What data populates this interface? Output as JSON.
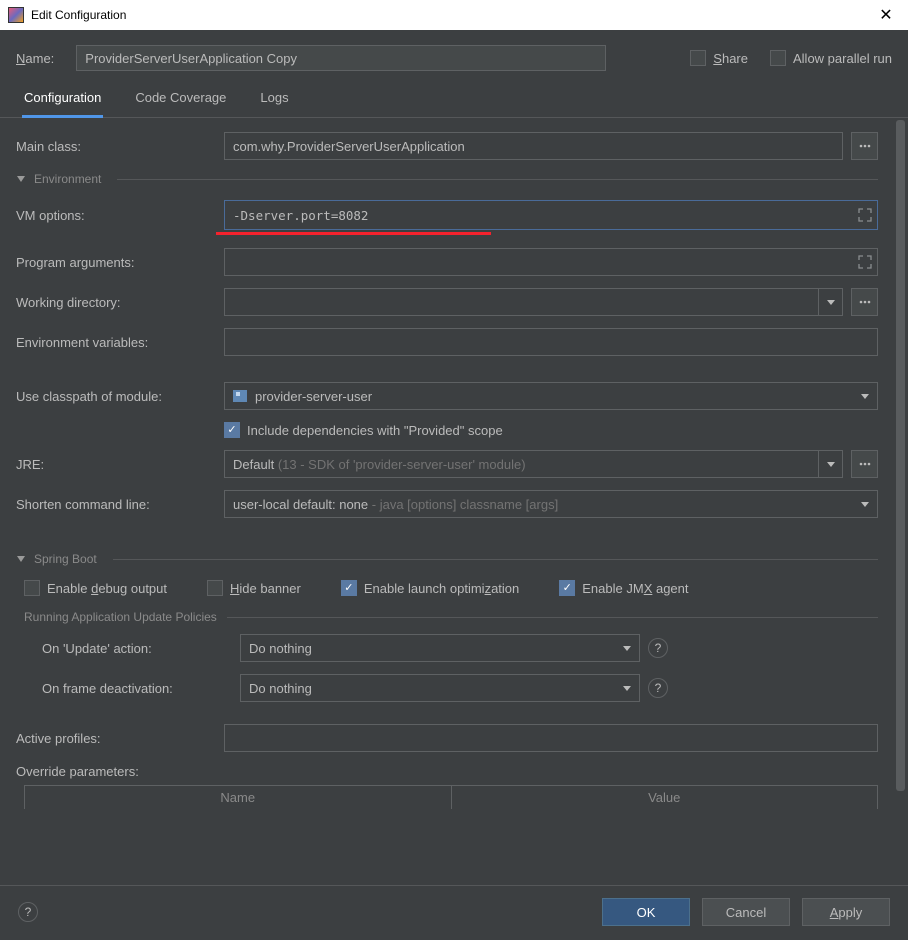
{
  "title": "Edit Configuration",
  "name": {
    "label": "Name:",
    "value": "ProviderServerUserApplication Copy"
  },
  "topChecks": {
    "share": "Share",
    "allowParallel": "Allow parallel run"
  },
  "tabs": {
    "configuration": "Configuration",
    "codeCoverage": "Code Coverage",
    "logs": "Logs"
  },
  "mainClass": {
    "label": "Main class:",
    "value": "com.why.ProviderServerUserApplication"
  },
  "sections": {
    "environment": "Environment",
    "springBoot": "Spring Boot",
    "updatePolicies": "Running Application Update Policies"
  },
  "vmOptions": {
    "label": "VM options:",
    "value": "-Dserver.port=8082"
  },
  "programArgs": {
    "label": "Program arguments:",
    "value": ""
  },
  "workingDir": {
    "label": "Working directory:",
    "value": ""
  },
  "envVars": {
    "label": "Environment variables:",
    "value": ""
  },
  "classpath": {
    "label": "Use classpath of module:",
    "value": "provider-server-user"
  },
  "includeProvided": "Include dependencies with \"Provided\" scope",
  "jre": {
    "label": "JRE:",
    "prefix": "Default ",
    "detail": "(13 - SDK of 'provider-server-user' module)"
  },
  "shorten": {
    "label": "Shorten command line:",
    "prefix": "user-local default: none",
    "detail": " - java [options] classname [args]"
  },
  "springChecks": {
    "debugOutput": "Enable debug output",
    "hideBanner": "Hide banner",
    "launchOpt": "Enable launch optimization",
    "jmxAgent": "Enable JMX agent"
  },
  "updateAction": {
    "label": "On 'Update' action:",
    "value": "Do nothing"
  },
  "frameDeactivation": {
    "label": "On frame deactivation:",
    "value": "Do nothing"
  },
  "activeProfiles": {
    "label": "Active profiles:",
    "value": ""
  },
  "overrideParams": {
    "label": "Override parameters:",
    "columns": {
      "name": "Name",
      "value": "Value"
    }
  },
  "buttons": {
    "ok": "OK",
    "cancel": "Cancel",
    "apply": "Apply"
  }
}
